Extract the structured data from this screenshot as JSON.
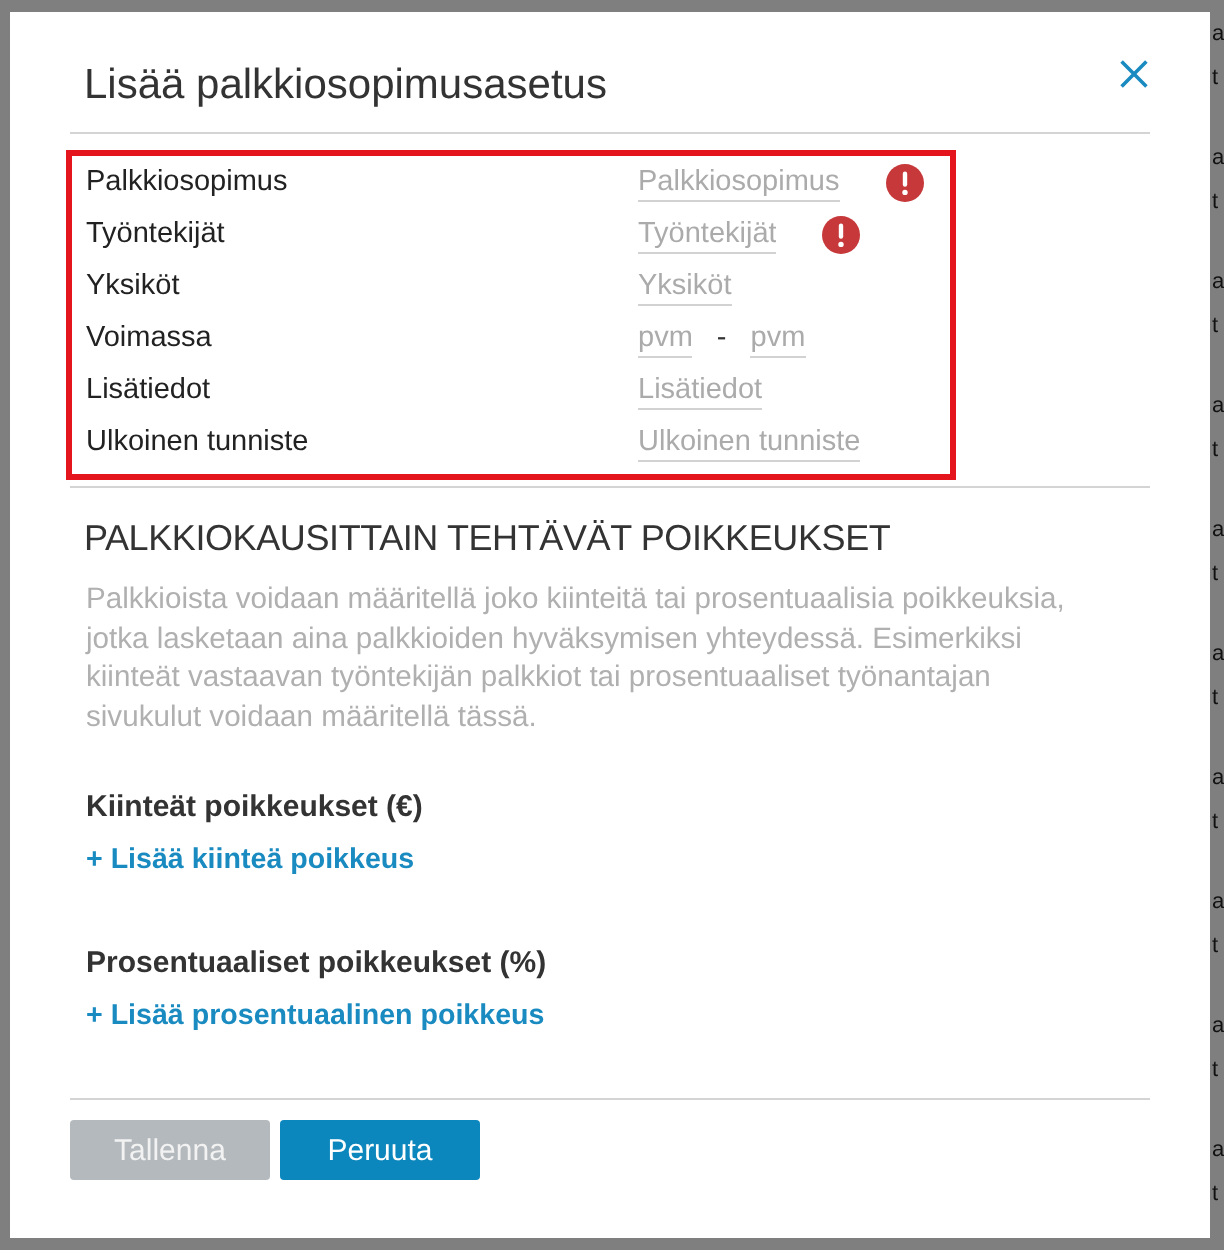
{
  "dialog": {
    "title": "Lisää palkkiosopimusasetus"
  },
  "form": {
    "highlighted": true,
    "fields": [
      {
        "label": "Palkkiosopimus",
        "kind": "text",
        "placeholder": "Palkkiosopimus",
        "error": true
      },
      {
        "label": "Työntekijät",
        "kind": "text",
        "placeholder": "Työntekijät",
        "error": true
      },
      {
        "label": "Yksiköt",
        "kind": "text",
        "placeholder": "Yksiköt",
        "error": false
      },
      {
        "label": "Voimassa",
        "kind": "date_range",
        "placeholders": [
          "pvm",
          "pvm"
        ],
        "separator": "-",
        "error": false
      },
      {
        "label": "Lisätiedot",
        "kind": "text",
        "placeholder": "Lisätiedot",
        "error": false
      },
      {
        "label": "Ulkoinen tunniste",
        "kind": "text",
        "placeholder": "Ulkoinen tunniste",
        "error": false
      }
    ]
  },
  "exceptions": {
    "heading": "PALKKIOKAUSITTAIN TEHTÄVÄT POIKKEUKSET",
    "description": "Palkkioista voidaan määritellä joko kiinteitä tai prosentuaalisia poikkeuksia, jotka lasketaan aina palkkioiden hyväksymisen yhteydessä. Esimerkiksi kiinteät vastaavan työntekijän palkkiot tai prosentuaaliset työnantajan sivukulut voidaan määritellä tässä.",
    "groups": [
      {
        "title": "Kiinteät poikkeukset (€)",
        "add_link": "+ Lisää kiinteä poikkeus"
      },
      {
        "title": "Prosentuaaliset poikkeukset (%)",
        "add_link": "+ Lisää prosentuaalinen poikkeus"
      }
    ]
  },
  "buttons": [
    {
      "label": "Tallenna",
      "disabled": true
    },
    {
      "label": "Peruuta",
      "disabled": false
    }
  ],
  "background_page": {
    "rows": [
      {
        "line_1": "a",
        "line_2": "t"
      },
      {
        "line_1": "a",
        "line_2": "t"
      },
      {
        "line_1": "a",
        "line_2": "t"
      },
      {
        "line_1": "a",
        "line_2": "t"
      },
      {
        "line_1": "a",
        "line_2": "t"
      },
      {
        "line_1": "a",
        "line_2": "t"
      },
      {
        "line_1": "a",
        "line_2": "t"
      },
      {
        "line_1": "a",
        "line_2": "t"
      },
      {
        "line_1": "a",
        "line_2": "t"
      },
      {
        "line_1": "a",
        "line_2": "t"
      }
    ]
  }
}
